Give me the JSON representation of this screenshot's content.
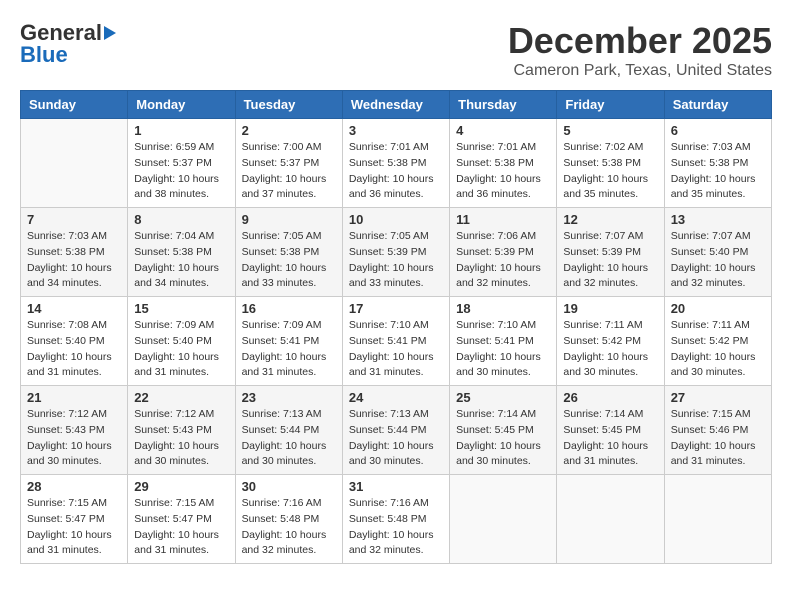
{
  "logo": {
    "general": "General",
    "blue": "Blue"
  },
  "header": {
    "month": "December 2025",
    "location": "Cameron Park, Texas, United States"
  },
  "weekdays": [
    "Sunday",
    "Monday",
    "Tuesday",
    "Wednesday",
    "Thursday",
    "Friday",
    "Saturday"
  ],
  "weeks": [
    [
      {
        "day": "",
        "sunrise": "",
        "sunset": "",
        "daylight": ""
      },
      {
        "day": "1",
        "sunrise": "Sunrise: 6:59 AM",
        "sunset": "Sunset: 5:37 PM",
        "daylight": "Daylight: 10 hours and 38 minutes."
      },
      {
        "day": "2",
        "sunrise": "Sunrise: 7:00 AM",
        "sunset": "Sunset: 5:37 PM",
        "daylight": "Daylight: 10 hours and 37 minutes."
      },
      {
        "day": "3",
        "sunrise": "Sunrise: 7:01 AM",
        "sunset": "Sunset: 5:38 PM",
        "daylight": "Daylight: 10 hours and 36 minutes."
      },
      {
        "day": "4",
        "sunrise": "Sunrise: 7:01 AM",
        "sunset": "Sunset: 5:38 PM",
        "daylight": "Daylight: 10 hours and 36 minutes."
      },
      {
        "day": "5",
        "sunrise": "Sunrise: 7:02 AM",
        "sunset": "Sunset: 5:38 PM",
        "daylight": "Daylight: 10 hours and 35 minutes."
      },
      {
        "day": "6",
        "sunrise": "Sunrise: 7:03 AM",
        "sunset": "Sunset: 5:38 PM",
        "daylight": "Daylight: 10 hours and 35 minutes."
      }
    ],
    [
      {
        "day": "7",
        "sunrise": "Sunrise: 7:03 AM",
        "sunset": "Sunset: 5:38 PM",
        "daylight": "Daylight: 10 hours and 34 minutes."
      },
      {
        "day": "8",
        "sunrise": "Sunrise: 7:04 AM",
        "sunset": "Sunset: 5:38 PM",
        "daylight": "Daylight: 10 hours and 34 minutes."
      },
      {
        "day": "9",
        "sunrise": "Sunrise: 7:05 AM",
        "sunset": "Sunset: 5:38 PM",
        "daylight": "Daylight: 10 hours and 33 minutes."
      },
      {
        "day": "10",
        "sunrise": "Sunrise: 7:05 AM",
        "sunset": "Sunset: 5:39 PM",
        "daylight": "Daylight: 10 hours and 33 minutes."
      },
      {
        "day": "11",
        "sunrise": "Sunrise: 7:06 AM",
        "sunset": "Sunset: 5:39 PM",
        "daylight": "Daylight: 10 hours and 32 minutes."
      },
      {
        "day": "12",
        "sunrise": "Sunrise: 7:07 AM",
        "sunset": "Sunset: 5:39 PM",
        "daylight": "Daylight: 10 hours and 32 minutes."
      },
      {
        "day": "13",
        "sunrise": "Sunrise: 7:07 AM",
        "sunset": "Sunset: 5:40 PM",
        "daylight": "Daylight: 10 hours and 32 minutes."
      }
    ],
    [
      {
        "day": "14",
        "sunrise": "Sunrise: 7:08 AM",
        "sunset": "Sunset: 5:40 PM",
        "daylight": "Daylight: 10 hours and 31 minutes."
      },
      {
        "day": "15",
        "sunrise": "Sunrise: 7:09 AM",
        "sunset": "Sunset: 5:40 PM",
        "daylight": "Daylight: 10 hours and 31 minutes."
      },
      {
        "day": "16",
        "sunrise": "Sunrise: 7:09 AM",
        "sunset": "Sunset: 5:41 PM",
        "daylight": "Daylight: 10 hours and 31 minutes."
      },
      {
        "day": "17",
        "sunrise": "Sunrise: 7:10 AM",
        "sunset": "Sunset: 5:41 PM",
        "daylight": "Daylight: 10 hours and 31 minutes."
      },
      {
        "day": "18",
        "sunrise": "Sunrise: 7:10 AM",
        "sunset": "Sunset: 5:41 PM",
        "daylight": "Daylight: 10 hours and 30 minutes."
      },
      {
        "day": "19",
        "sunrise": "Sunrise: 7:11 AM",
        "sunset": "Sunset: 5:42 PM",
        "daylight": "Daylight: 10 hours and 30 minutes."
      },
      {
        "day": "20",
        "sunrise": "Sunrise: 7:11 AM",
        "sunset": "Sunset: 5:42 PM",
        "daylight": "Daylight: 10 hours and 30 minutes."
      }
    ],
    [
      {
        "day": "21",
        "sunrise": "Sunrise: 7:12 AM",
        "sunset": "Sunset: 5:43 PM",
        "daylight": "Daylight: 10 hours and 30 minutes."
      },
      {
        "day": "22",
        "sunrise": "Sunrise: 7:12 AM",
        "sunset": "Sunset: 5:43 PM",
        "daylight": "Daylight: 10 hours and 30 minutes."
      },
      {
        "day": "23",
        "sunrise": "Sunrise: 7:13 AM",
        "sunset": "Sunset: 5:44 PM",
        "daylight": "Daylight: 10 hours and 30 minutes."
      },
      {
        "day": "24",
        "sunrise": "Sunrise: 7:13 AM",
        "sunset": "Sunset: 5:44 PM",
        "daylight": "Daylight: 10 hours and 30 minutes."
      },
      {
        "day": "25",
        "sunrise": "Sunrise: 7:14 AM",
        "sunset": "Sunset: 5:45 PM",
        "daylight": "Daylight: 10 hours and 30 minutes."
      },
      {
        "day": "26",
        "sunrise": "Sunrise: 7:14 AM",
        "sunset": "Sunset: 5:45 PM",
        "daylight": "Daylight: 10 hours and 31 minutes."
      },
      {
        "day": "27",
        "sunrise": "Sunrise: 7:15 AM",
        "sunset": "Sunset: 5:46 PM",
        "daylight": "Daylight: 10 hours and 31 minutes."
      }
    ],
    [
      {
        "day": "28",
        "sunrise": "Sunrise: 7:15 AM",
        "sunset": "Sunset: 5:47 PM",
        "daylight": "Daylight: 10 hours and 31 minutes."
      },
      {
        "day": "29",
        "sunrise": "Sunrise: 7:15 AM",
        "sunset": "Sunset: 5:47 PM",
        "daylight": "Daylight: 10 hours and 31 minutes."
      },
      {
        "day": "30",
        "sunrise": "Sunrise: 7:16 AM",
        "sunset": "Sunset: 5:48 PM",
        "daylight": "Daylight: 10 hours and 32 minutes."
      },
      {
        "day": "31",
        "sunrise": "Sunrise: 7:16 AM",
        "sunset": "Sunset: 5:48 PM",
        "daylight": "Daylight: 10 hours and 32 minutes."
      },
      {
        "day": "",
        "sunrise": "",
        "sunset": "",
        "daylight": ""
      },
      {
        "day": "",
        "sunrise": "",
        "sunset": "",
        "daylight": ""
      },
      {
        "day": "",
        "sunrise": "",
        "sunset": "",
        "daylight": ""
      }
    ]
  ]
}
